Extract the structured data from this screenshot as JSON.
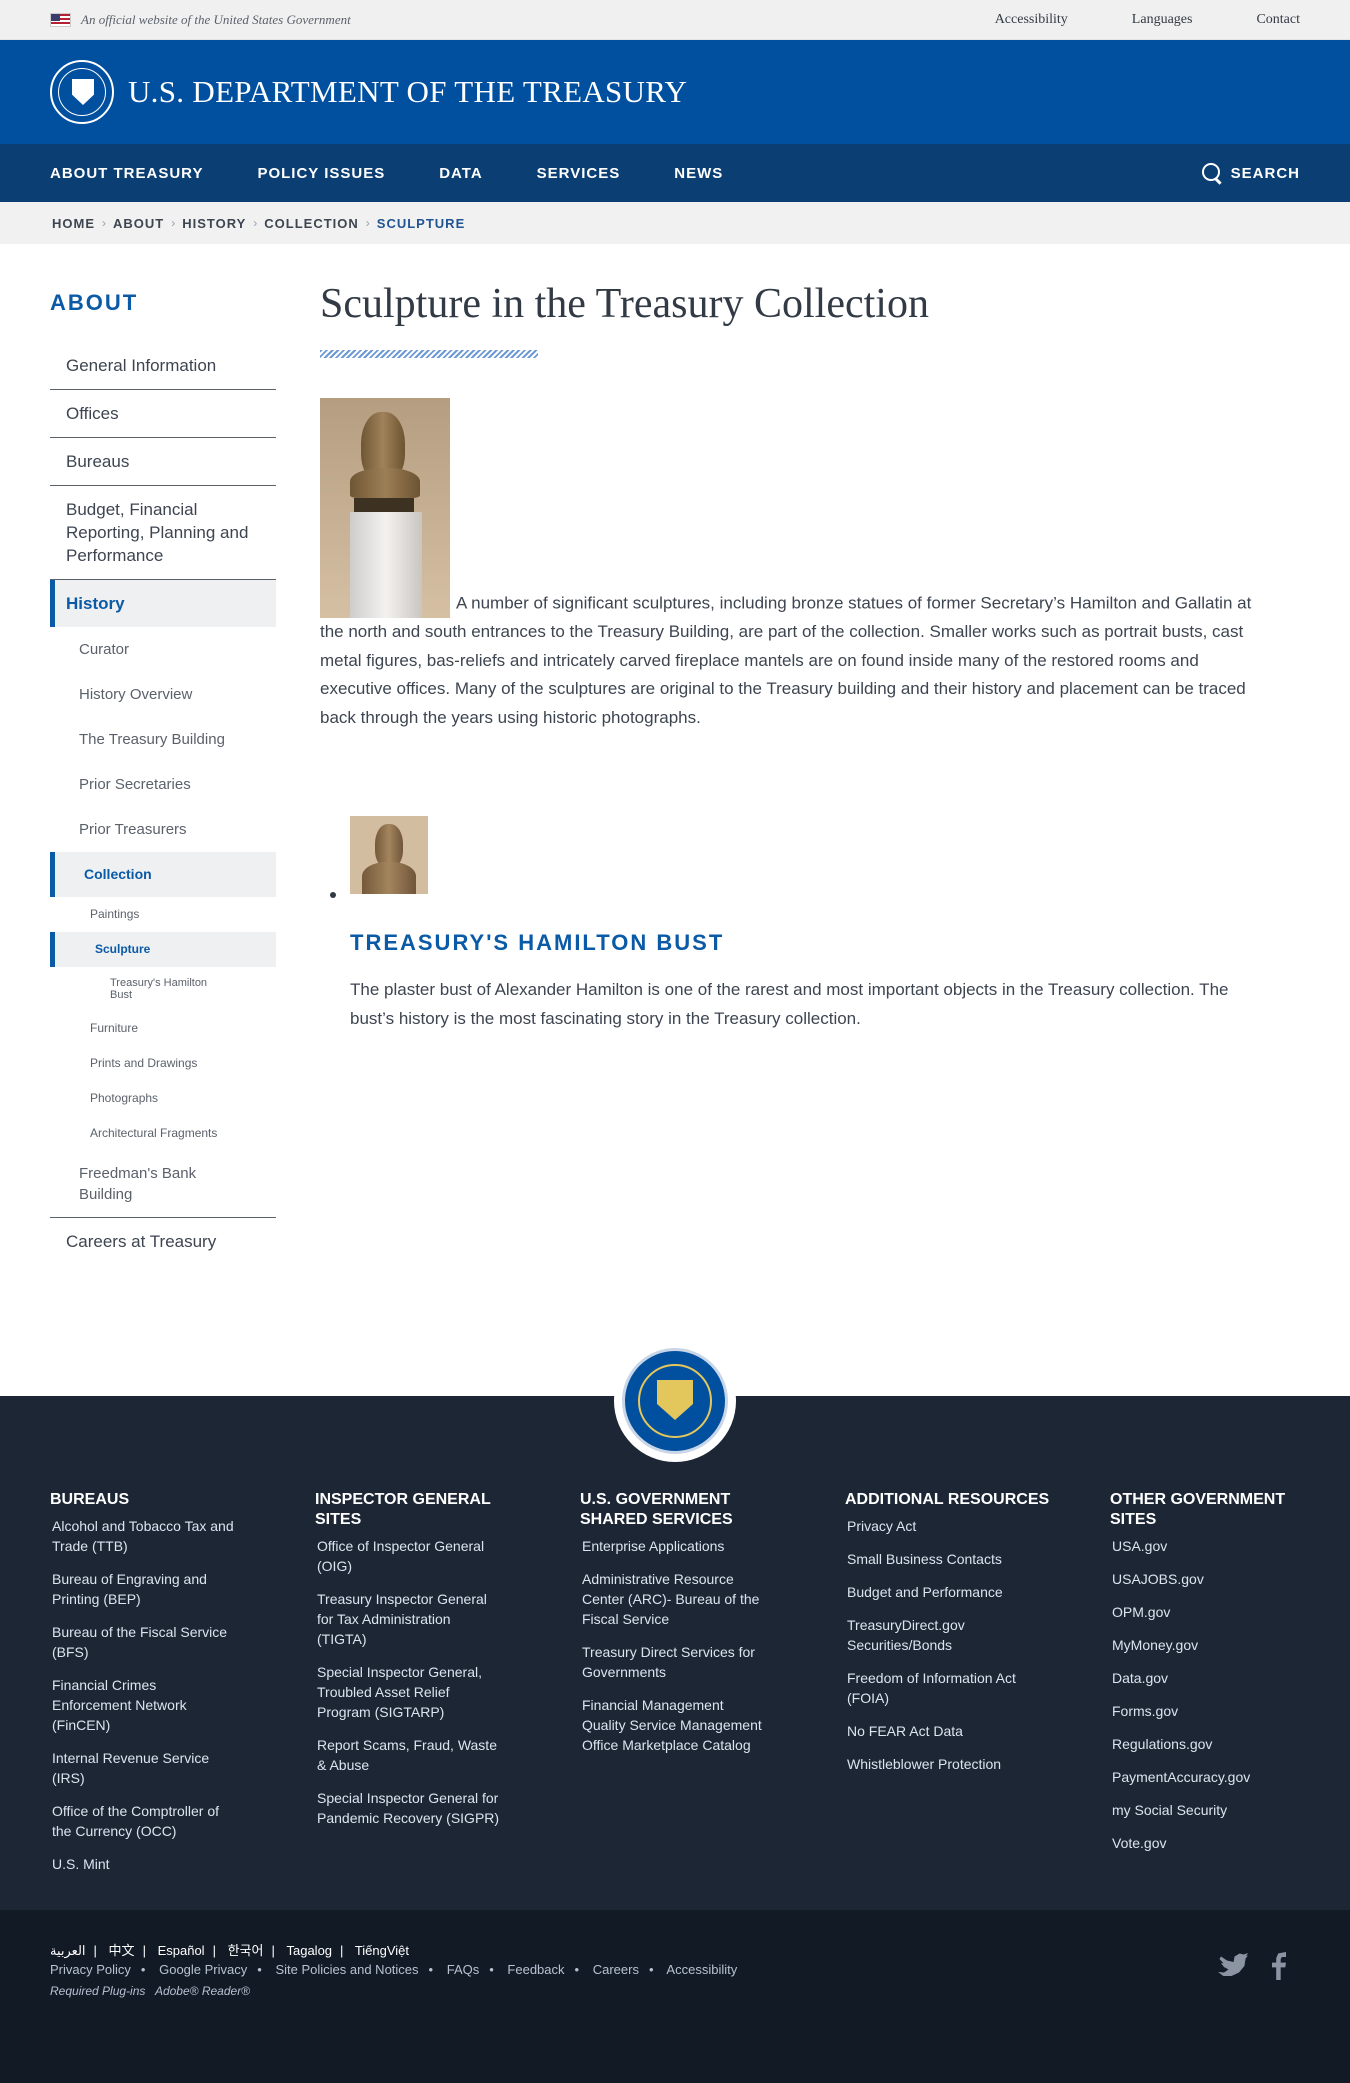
{
  "gov_banner": {
    "text": "An official website of the United States Government",
    "links": [
      "Accessibility",
      "Languages",
      "Contact"
    ]
  },
  "header": {
    "title": "U.S. DEPARTMENT OF THE TREASURY"
  },
  "nav": {
    "items": [
      "ABOUT TREASURY",
      "POLICY ISSUES",
      "DATA",
      "SERVICES",
      "NEWS"
    ],
    "search_label": "SEARCH"
  },
  "breadcrumb": [
    "HOME",
    "ABOUT",
    "HISTORY",
    "COLLECTION",
    "SCULPTURE"
  ],
  "sidebar": {
    "heading": "ABOUT",
    "general": "General Information",
    "offices": "Offices",
    "bureaus": "Bureaus",
    "budget": "Budget, Financial Reporting, Planning and Performance",
    "history": "History",
    "curator": "Curator",
    "history_overview": "History Overview",
    "treasury_building": "The Treasury Building",
    "prior_secretaries": "Prior Secretaries",
    "prior_treasurers": "Prior Treasurers",
    "collection": "Collection",
    "paintings": "Paintings",
    "sculpture": "Sculpture",
    "hamilton_bust": "Treasury's Hamilton Bust",
    "furniture": "Furniture",
    "prints": "Prints and Drawings",
    "photographs": "Photographs",
    "architectural": "Architectural Fragments",
    "freedman": "Freedman's Bank Building",
    "careers": "Careers at Treasury"
  },
  "main": {
    "title": "Sculpture in the Treasury Collection",
    "intro": "A number of significant sculptures, including bronze statues of former Secretary’s Hamilton and Gallatin at the north and south entrances to the Treasury Building, are part of the collection. Smaller works such as portrait busts, cast metal figures, bas-reliefs and intricately carved fireplace mantels are on found inside many of the restored rooms and executive offices. Many of the sculptures are original to the Treasury building and their history and placement can be traced back through the years using historic photographs.",
    "related_title": "TREASURY'S HAMILTON BUST",
    "related_text": "The plaster bust of Alexander Hamilton is one of the rarest and most important objects in the Treasury collection. The bust’s history is the most fascinating story in the Treasury collection."
  },
  "footer": {
    "bureaus": {
      "heading": "BUREAUS",
      "links": [
        "Alcohol and Tobacco Tax and Trade (TTB)",
        "Bureau of Engraving and Printing (BEP)",
        "Bureau of the Fiscal Service (BFS)",
        "Financial Crimes Enforcement Network (FinCEN)",
        "Internal Revenue Service (IRS)",
        "Office of the Comptroller of the Currency (OCC)",
        "U.S. Mint"
      ]
    },
    "ig": {
      "heading": "INSPECTOR GENERAL SITES",
      "links": [
        "Office of Inspector General (OIG)",
        "Treasury Inspector General for Tax Administration (TIGTA)",
        "Special Inspector General, Troubled Asset Relief Program (SIGTARP)",
        "Report Scams, Fraud, Waste & Abuse",
        "Special Inspector General for Pandemic Recovery (SIGPR)"
      ]
    },
    "shared": {
      "heading": "U.S. GOVERNMENT SHARED SERVICES",
      "links": [
        "Enterprise Applications",
        "Administrative Resource Center (ARC)- Bureau of the Fiscal Service",
        "Treasury Direct Services for Governments",
        "Financial Management Quality Service Management Office Marketplace Catalog"
      ]
    },
    "additional": {
      "heading": "ADDITIONAL RESOURCES",
      "links": [
        "Privacy Act",
        "Small Business Contacts",
        "Budget and Performance",
        "TreasuryDirect.gov Securities/Bonds",
        "Freedom of Information Act (FOIA)",
        "No FEAR Act Data",
        "Whistleblower Protection"
      ]
    },
    "other": {
      "heading": "OTHER GOVERNMENT SITES",
      "links": [
        "USA.gov",
        "USAJOBS.gov",
        "OPM.gov",
        "MyMoney.gov",
        "Data.gov",
        "Forms.gov",
        "Regulations.gov",
        "PaymentAccuracy.gov",
        "my Social Security",
        "Vote.gov"
      ]
    }
  },
  "sub_footer": {
    "languages": [
      "العربية",
      "中文",
      "Español",
      "한국어",
      "Tagalog",
      "TiếngViệt"
    ],
    "links": [
      "Privacy Policy",
      "Google Privacy",
      "Site Policies and Notices",
      "FAQs",
      "Feedback",
      "Careers",
      "Accessibility"
    ],
    "plugins_label": "Required Plug-ins",
    "plugin_name": "Adobe® Reader®"
  }
}
